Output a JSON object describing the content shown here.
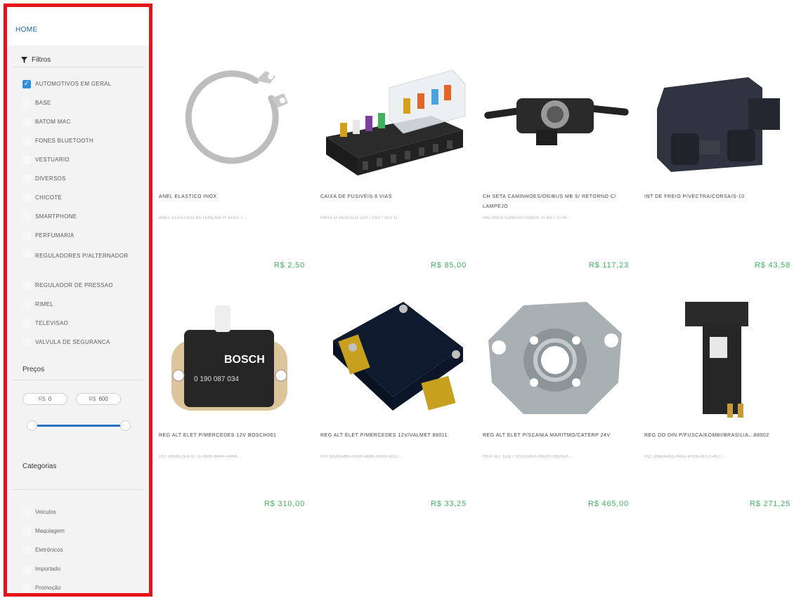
{
  "nav": {
    "home": "HOME"
  },
  "filters": {
    "title": "Filtros",
    "items": [
      {
        "label": "AUTOMOTIVOS EM GERAL",
        "checked": true
      },
      {
        "label": "BASE",
        "checked": false
      },
      {
        "label": "BATOM MAC",
        "checked": false
      },
      {
        "label": "FONES BLUETOOTH",
        "checked": false
      },
      {
        "label": "VESTUARIO",
        "checked": false
      },
      {
        "label": "DIVERSOS",
        "checked": false
      },
      {
        "label": "CHICOTE",
        "checked": false
      },
      {
        "label": "SMARTPHONE",
        "checked": false
      },
      {
        "label": "PERFUMARIA",
        "checked": false
      },
      {
        "label": "REGULADORES P/ALTERNADOR",
        "checked": false
      },
      {
        "label": "REGULADOR DE PRESSAO",
        "checked": false
      },
      {
        "label": "RIMEL",
        "checked": false
      },
      {
        "label": "TELEVISAO",
        "checked": false
      },
      {
        "label": "VALVULA DE SEGURANCA",
        "checked": false
      }
    ]
  },
  "prices": {
    "title": "Preços",
    "currency": "R$",
    "min": "0",
    "max": "600"
  },
  "categories": {
    "title": "Categorias",
    "items": [
      "Veiculos",
      "Maquiagem",
      "Eletrônicos",
      "Importado",
      "Promoção"
    ]
  },
  "products": [
    {
      "name": "ANEL ELASTICO INOX",
      "desc": "ANEL ELASTICO RETENÇÃO P/ EIXO T...",
      "price": "R$ 2,50",
      "icon": "retaining-ring-icon"
    },
    {
      "name": "CAIXA DE FUSIVEIS 8 VIAS",
      "desc": "PARA O VEICULO 12V / 24V / 32V D...",
      "price": "R$ 85,00",
      "icon": "fuse-box-icon"
    },
    {
      "name": "CH SETA CAMINHOES/ONIBUS MB S/ RETORNO C/ LAMPEJO",
      "desc": "PALANCA CAMI/AUTOBUS S/ RET C/ M...",
      "price": "R$ 117,23",
      "icon": "turn-signal-switch-icon"
    },
    {
      "name": "INT DE FREIO P/VECTRA/CORSA/S-10",
      "desc": "",
      "price": "R$ 43,58",
      "icon": "brake-switch-icon"
    },
    {
      "name": "REG ALT ELET P/MERCEDES 12V BOSCH001",
      "desc": "PCI 2989E2E3-9771-4600-8844-A466...",
      "price": "R$ 310,00",
      "icon": "voltage-regulator-icon"
    },
    {
      "name": "REG ALT ELET P/MERCEDES 12V/VALMET 88011",
      "desc": "PCI 5930D465-4169-4889-A009-5013...",
      "price": "R$ 33,25",
      "icon": "voltage-regulator-icon"
    },
    {
      "name": "REG ALT ELET P/SCANIA MARITMO/CATERP 24V",
      "desc": "REG ALT ELET P/SCANIA MARITIMO/CA...",
      "price": "R$ 465,00",
      "icon": "alternator-housing-icon"
    },
    {
      "name": "REG DO DIN P/FUSCA/KOMBI/BRASILIA...88002",
      "desc": "PCI 3564A405-0451-4099-AEE1-4577...",
      "price": "R$ 271,25",
      "icon": "regulator-relay-icon"
    }
  ]
}
